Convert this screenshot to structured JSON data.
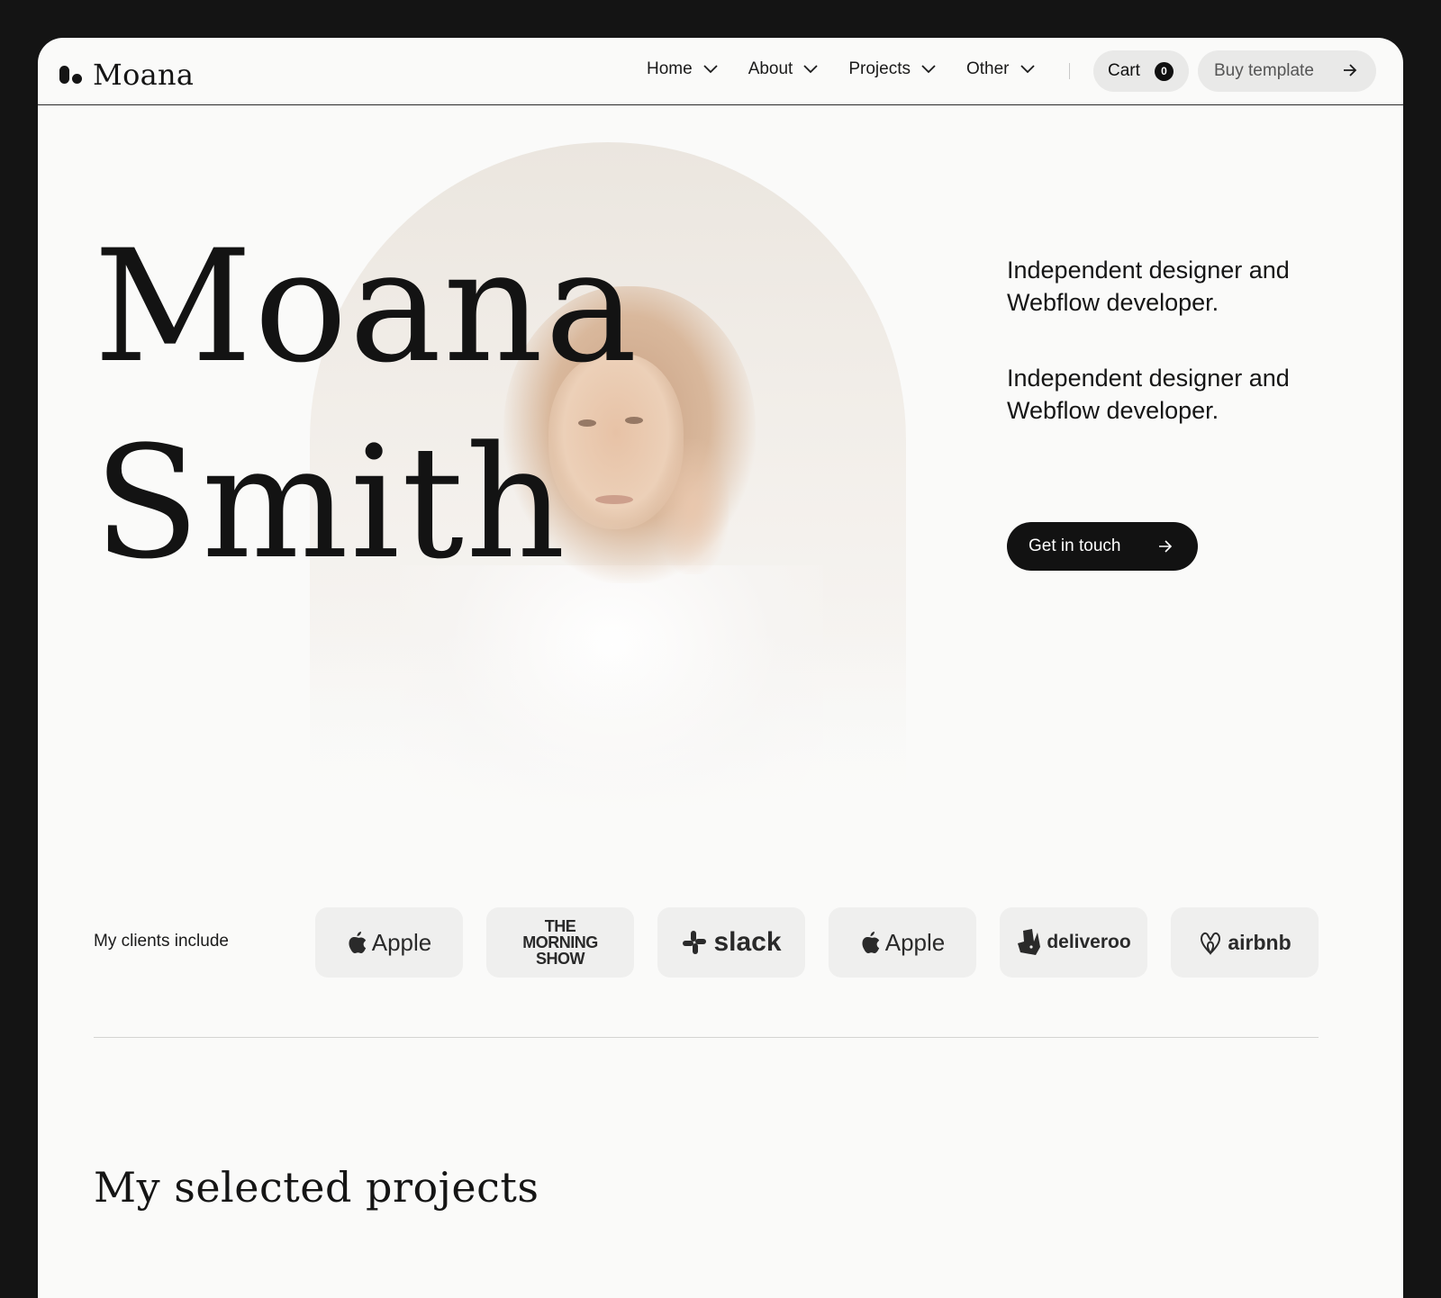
{
  "brand": {
    "name": "Moana"
  },
  "nav": {
    "items": [
      {
        "label": "Home"
      },
      {
        "label": "About"
      },
      {
        "label": "Projects"
      },
      {
        "label": "Other"
      }
    ],
    "cart": {
      "label": "Cart",
      "count": "0"
    },
    "buy": {
      "label": "Buy template"
    }
  },
  "hero": {
    "name_line1": "Moana",
    "name_line2": "Smith",
    "tagline1": "Independent designer and Webflow developer.",
    "tagline2": "Independent designer and Webflow developer.",
    "cta": "Get in touch"
  },
  "clients": {
    "label": "My clients include",
    "logos": [
      {
        "name": "Apple",
        "icon": "apple-icon"
      },
      {
        "name": "THE MORNING SHOW",
        "icon": "morning-show-logo"
      },
      {
        "name": "slack",
        "icon": "slack-icon"
      },
      {
        "name": "Apple",
        "icon": "apple-icon"
      },
      {
        "name": "deliveroo",
        "icon": "deliveroo-icon"
      },
      {
        "name": "airbnb",
        "icon": "airbnb-icon"
      }
    ]
  },
  "projects": {
    "title": "My selected projects"
  },
  "colors": {
    "background": "#141414",
    "page": "#fafaf9",
    "accent": "#121212",
    "pill": "#e9e9e8"
  }
}
